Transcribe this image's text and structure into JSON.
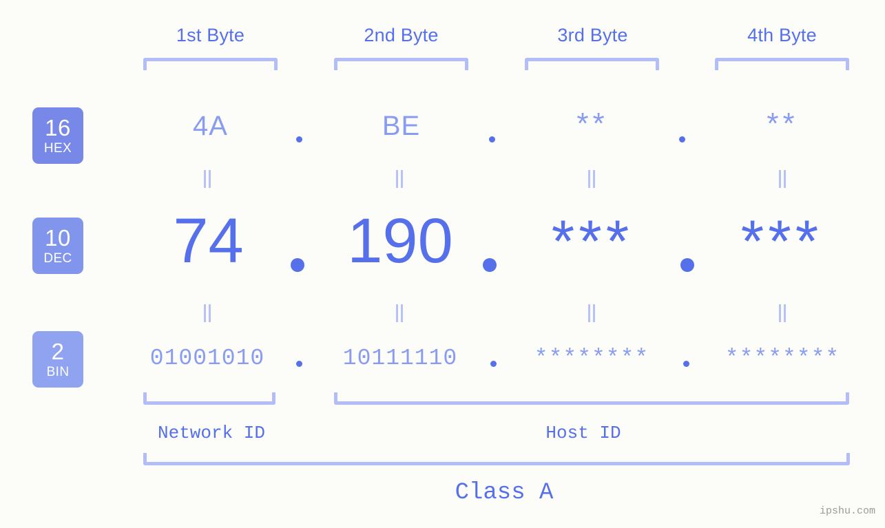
{
  "watermark": "ipshu.com",
  "byte_headers": [
    {
      "label": "1st Byte"
    },
    {
      "label": "2nd Byte"
    },
    {
      "label": "3rd Byte"
    },
    {
      "label": "4th Byte"
    }
  ],
  "bases": [
    {
      "number": "16",
      "name": "HEX",
      "color": "#7788e8"
    },
    {
      "number": "10",
      "name": "DEC",
      "color": "#8295ec"
    },
    {
      "number": "2",
      "name": "BIN",
      "color": "#8fa3f0"
    }
  ],
  "rows": {
    "hex": {
      "values": [
        "4A",
        "BE",
        "**",
        "**"
      ]
    },
    "dec": {
      "values": [
        "74",
        "190",
        "***",
        "***"
      ]
    },
    "bin": {
      "values": [
        "01001010",
        "10111110",
        "********",
        "********"
      ]
    }
  },
  "separator": ".",
  "equality_marker": "||",
  "regions": [
    {
      "label": "Network ID"
    },
    {
      "label": "Host ID"
    }
  ],
  "class_label": "Class A",
  "colors": {
    "background": "#fcfdf9",
    "accent_strong": "#5570ea",
    "accent_light": "#8a9bf2",
    "bracket": "#b3bdf7"
  }
}
